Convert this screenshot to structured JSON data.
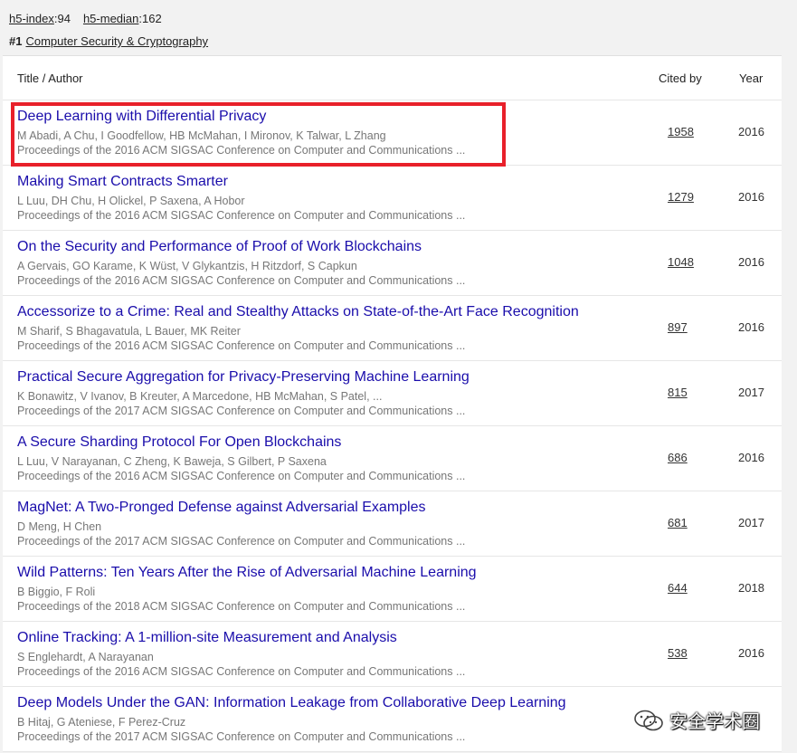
{
  "metrics": {
    "h5_index_label": "h5-index",
    "h5_index_value": ":94",
    "h5_median_label": "h5-median",
    "h5_median_value": ":162"
  },
  "category": {
    "rank": "#1",
    "name": "Computer Security & Cryptography"
  },
  "table": {
    "headers": {
      "title": "Title / Author",
      "cited": "Cited by",
      "year": "Year"
    },
    "rows": [
      {
        "title": "Deep Learning with Differential Privacy",
        "authors": "M Abadi, A Chu, I Goodfellow, HB McMahan, I Mironov, K Talwar, L Zhang",
        "venue": "Proceedings of the 2016 ACM SIGSAC Conference on Computer and Communications ...",
        "cited": "1958",
        "year": "2016"
      },
      {
        "title": "Making Smart Contracts Smarter",
        "authors": "L Luu, DH Chu, H Olickel, P Saxena, A Hobor",
        "venue": "Proceedings of the 2016 ACM SIGSAC Conference on Computer and Communications ...",
        "cited": "1279",
        "year": "2016"
      },
      {
        "title": "On the Security and Performance of Proof of Work Blockchains",
        "authors": "A Gervais, GO Karame, K Wüst, V Glykantzis, H Ritzdorf, S Capkun",
        "venue": "Proceedings of the 2016 ACM SIGSAC Conference on Computer and Communications ...",
        "cited": "1048",
        "year": "2016"
      },
      {
        "title": "Accessorize to a Crime: Real and Stealthy Attacks on State-of-the-Art Face Recognition",
        "authors": "M Sharif, S Bhagavatula, L Bauer, MK Reiter",
        "venue": "Proceedings of the 2016 ACM SIGSAC Conference on Computer and Communications ...",
        "cited": "897",
        "year": "2016"
      },
      {
        "title": "Practical Secure Aggregation for Privacy-Preserving Machine Learning",
        "authors": "K Bonawitz, V Ivanov, B Kreuter, A Marcedone, HB McMahan, S Patel, ...",
        "venue": "Proceedings of the 2017 ACM SIGSAC Conference on Computer and Communications ...",
        "cited": "815",
        "year": "2017"
      },
      {
        "title": "A Secure Sharding Protocol For Open Blockchains",
        "authors": "L Luu, V Narayanan, C Zheng, K Baweja, S Gilbert, P Saxena",
        "venue": "Proceedings of the 2016 ACM SIGSAC Conference on Computer and Communications ...",
        "cited": "686",
        "year": "2016"
      },
      {
        "title": "MagNet: A Two-Pronged Defense against Adversarial Examples",
        "authors": "D Meng, H Chen",
        "venue": "Proceedings of the 2017 ACM SIGSAC Conference on Computer and Communications ...",
        "cited": "681",
        "year": "2017"
      },
      {
        "title": "Wild Patterns: Ten Years After the Rise of Adversarial Machine Learning",
        "authors": "B Biggio, F Roli",
        "venue": "Proceedings of the 2018 ACM SIGSAC Conference on Computer and Communications ...",
        "cited": "644",
        "year": "2018"
      },
      {
        "title": "Online Tracking: A 1-million-site Measurement and Analysis",
        "authors": "S Englehardt, A Narayanan",
        "venue": "Proceedings of the 2016 ACM SIGSAC Conference on Computer and Communications ...",
        "cited": "538",
        "year": "2016"
      },
      {
        "title": "Deep Models Under the GAN: Information Leakage from Collaborative Deep Learning",
        "authors": "B Hitaj, G Ateniese, F Perez-Cruz",
        "venue": "Proceedings of the 2017 ACM SIGSAC Conference on Computer and Communications ...",
        "cited": "",
        "year": ""
      }
    ]
  },
  "watermark": {
    "text": "安全学术圈",
    "icon": "wechat-icon"
  },
  "colors": {
    "title_link": "#1a0dab",
    "highlight_border": "#e8202a",
    "meta_text": "#777777"
  }
}
